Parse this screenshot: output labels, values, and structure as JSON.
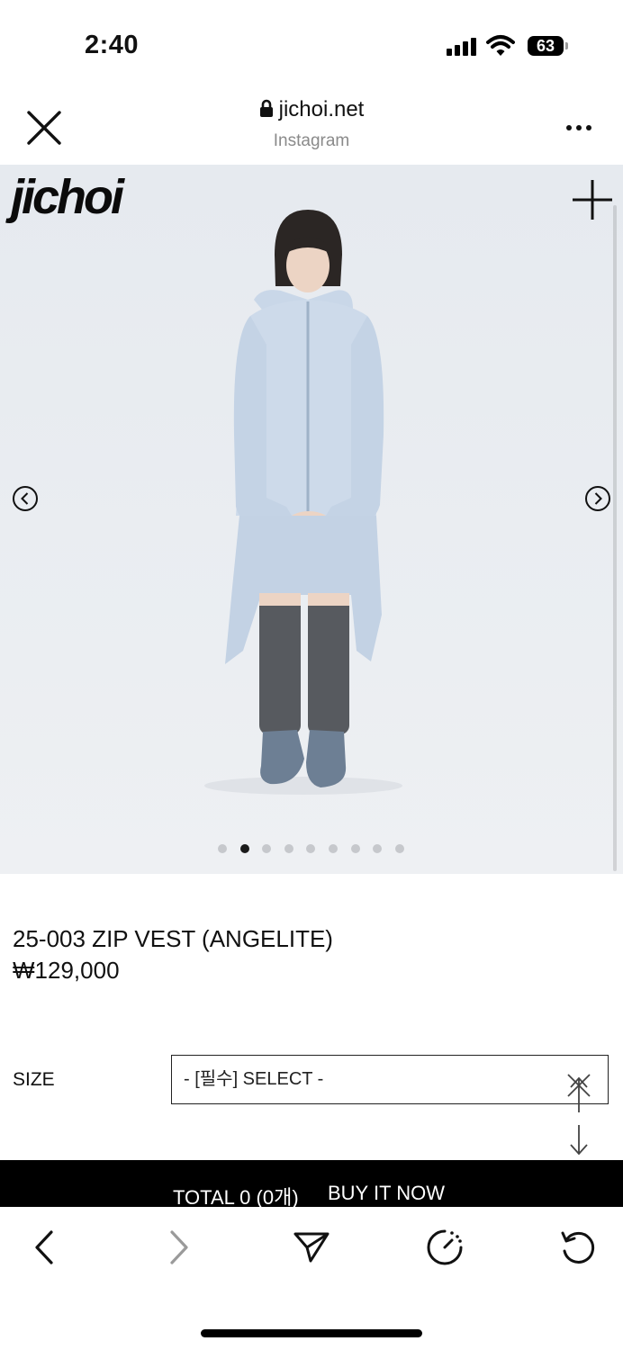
{
  "status_bar": {
    "time": "2:40",
    "battery": "63",
    "icons": [
      "signal-icon",
      "wifi-icon",
      "battery-icon"
    ]
  },
  "browser": {
    "domain": "jichoi.net",
    "source": "Instagram",
    "icons": [
      "close-icon",
      "lock-icon",
      "more-icon"
    ]
  },
  "hero": {
    "logo": "jichoi",
    "image_description_icon": "model-photo",
    "carousel": {
      "total": 9,
      "active_index": 1
    },
    "icons": [
      "plus-icon",
      "prev-arrow-icon",
      "next-arrow-icon"
    ]
  },
  "product": {
    "title": "25-003 ZIP VEST (ANGELITE)",
    "price": "₩129,000"
  },
  "options": {
    "size_label": "SIZE",
    "size_value": "- [필수] SELECT -"
  },
  "purchase": {
    "total": "TOTAL 0 (0개)",
    "buy": "BUY IT NOW"
  },
  "toolbar": {
    "icons": [
      "back-icon",
      "forward-icon",
      "share-icon",
      "speed-icon",
      "reload-icon"
    ]
  },
  "colors": {
    "background": "#ffffff",
    "hero_bg": "#e8ebef",
    "garment": "#c9d7e8",
    "bar": "#000000"
  }
}
